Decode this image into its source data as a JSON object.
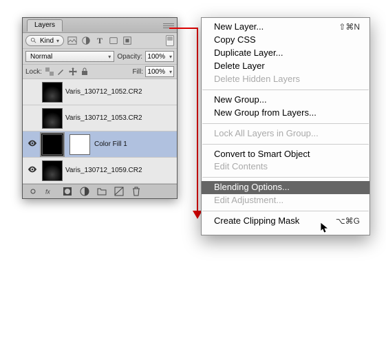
{
  "panel": {
    "tab": "Layers",
    "filter": {
      "kind_label": "Kind",
      "icon_names": [
        "image",
        "adjust",
        "type",
        "shape",
        "smart"
      ]
    },
    "blend": {
      "mode": "Normal",
      "opacity_label": "Opacity:",
      "opacity_value": "100%"
    },
    "lock": {
      "label": "Lock:",
      "fill_label": "Fill:",
      "fill_value": "100%"
    },
    "layers": [
      {
        "name": "Varis_130712_1052.CR2",
        "visible": false,
        "selected": false,
        "has_mask": false
      },
      {
        "name": "Varis_130712_1053.CR2",
        "visible": false,
        "selected": false,
        "has_mask": false
      },
      {
        "name": "Color Fill 1",
        "visible": true,
        "selected": true,
        "has_mask": true
      },
      {
        "name": "Varis_130712_1059.CR2",
        "visible": true,
        "selected": false,
        "has_mask": false
      }
    ]
  },
  "menu": {
    "groups": [
      [
        {
          "label": "New Layer...",
          "enabled": true,
          "shortcut": "⇧⌘N"
        },
        {
          "label": "Copy CSS",
          "enabled": true
        },
        {
          "label": "Duplicate Layer...",
          "enabled": true
        },
        {
          "label": "Delete Layer",
          "enabled": true
        },
        {
          "label": "Delete Hidden Layers",
          "enabled": false
        }
      ],
      [
        {
          "label": "New Group...",
          "enabled": true
        },
        {
          "label": "New Group from Layers...",
          "enabled": true
        }
      ],
      [
        {
          "label": "Lock All Layers in Group...",
          "enabled": false
        }
      ],
      [
        {
          "label": "Convert to Smart Object",
          "enabled": true
        },
        {
          "label": "Edit Contents",
          "enabled": false
        }
      ],
      [
        {
          "label": "Blending Options...",
          "enabled": true,
          "highlighted": true
        },
        {
          "label": "Edit Adjustment...",
          "enabled": false
        }
      ],
      [
        {
          "label": "Create Clipping Mask",
          "enabled": true,
          "shortcut": "⌥⌘G"
        }
      ]
    ]
  }
}
